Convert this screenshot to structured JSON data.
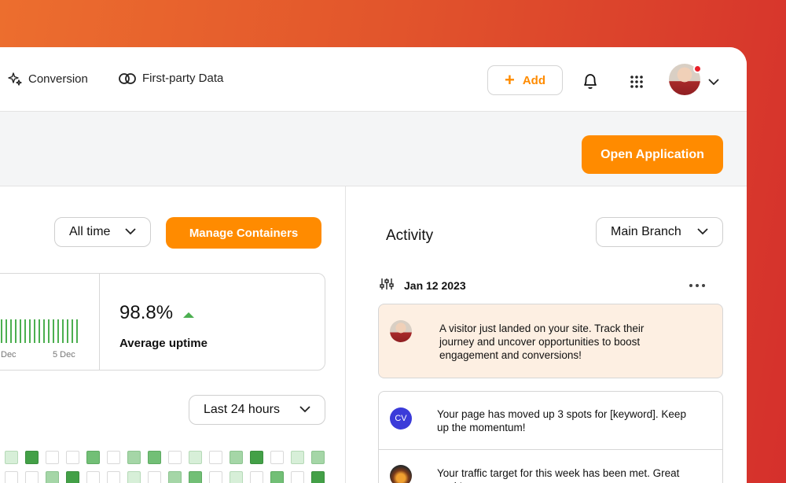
{
  "nav": {
    "items": [
      {
        "label": "Conversion",
        "icon": "sparkle-icon"
      },
      {
        "label": "First-party Data",
        "icon": "overlap-circles-icon"
      }
    ],
    "add_label": "Add",
    "add_icon": "plus-icon"
  },
  "subheader": {
    "open_app_label": "Open Application"
  },
  "containers": {
    "time_filter": "All time",
    "manage_label": "Manage Containers",
    "stats": {
      "uptime_value": "98.8%",
      "uptime_label": "Average uptime",
      "tick_labels": [
        "Dec",
        "5 Dec"
      ]
    },
    "range_filter": "Last 24 hours"
  },
  "activity": {
    "title": "Activity",
    "branch_filter": "Main Branch",
    "date": "Jan 12 2023",
    "items": [
      {
        "avatar": "user-photo",
        "text": "A visitor just landed on your site. Track their journey and uncover opportunities to boost engagement and conversions!"
      },
      {
        "avatar": "CV",
        "text": "Your page has moved up 3 spots for [keyword]. Keep up the momentum!"
      },
      {
        "avatar": "fire-photo",
        "text": "Your traffic target for this week has been met. Great work!"
      }
    ]
  },
  "colors": {
    "accent": "#ff8b00",
    "gradient_start": "#ec6e2e",
    "gradient_end": "#d5302c",
    "success": "#4caf50",
    "notification": "#e8202a"
  }
}
